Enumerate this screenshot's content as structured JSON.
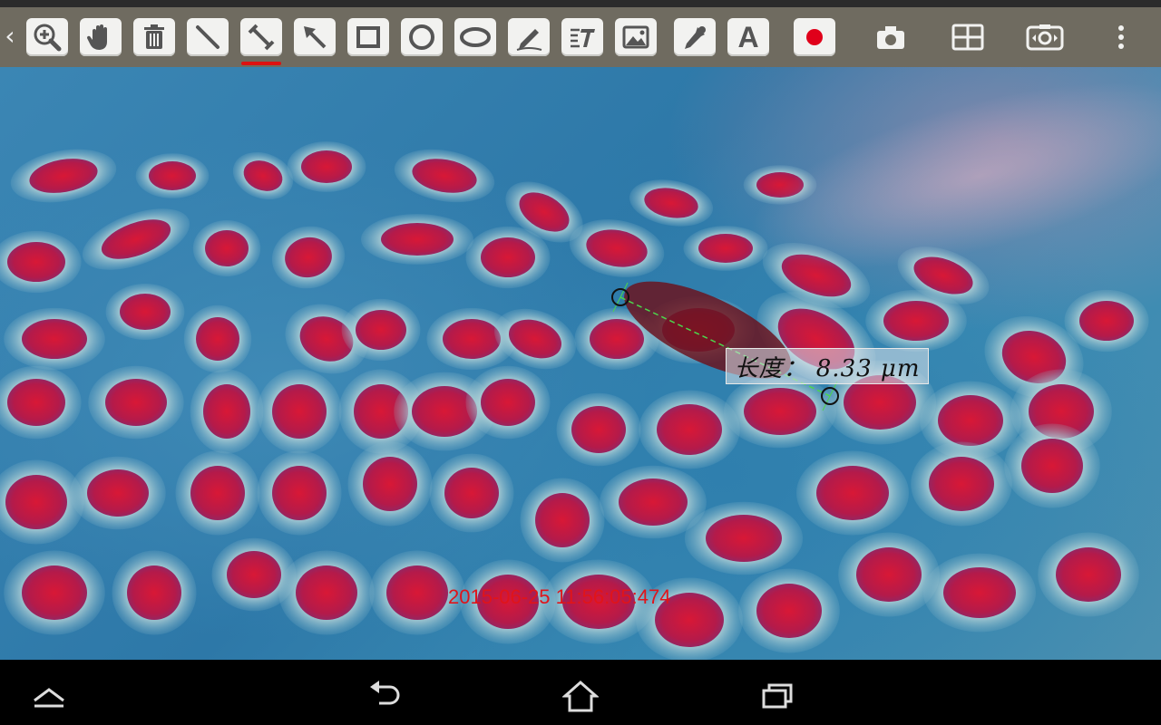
{
  "toolbar": {
    "back_glyph": "‹",
    "tools": [
      {
        "name": "zoom-icon",
        "label": "zoom"
      },
      {
        "name": "hand-icon",
        "label": "pan"
      },
      {
        "name": "trash-icon",
        "label": "delete"
      },
      {
        "name": "line-icon",
        "label": "line"
      },
      {
        "name": "measure-line-icon",
        "label": "measure line",
        "active": true
      },
      {
        "name": "arrow-icon",
        "label": "arrow"
      },
      {
        "name": "rectangle-icon",
        "label": "rectangle"
      },
      {
        "name": "circle-icon",
        "label": "circle"
      },
      {
        "name": "ellipse-icon",
        "label": "ellipse"
      },
      {
        "name": "pen-icon",
        "label": "freehand"
      },
      {
        "name": "text-style-icon",
        "label": "text style"
      },
      {
        "name": "image-icon",
        "label": "image"
      },
      {
        "name": "eyedropper-icon",
        "label": "color picker"
      },
      {
        "name": "text-icon",
        "label": "text"
      },
      {
        "name": "record-icon",
        "label": "record"
      },
      {
        "name": "snapshot-icon",
        "label": "snapshot"
      },
      {
        "name": "grid-icon",
        "label": "grid"
      },
      {
        "name": "camera-switch-icon",
        "label": "camera"
      },
      {
        "name": "overflow-menu-icon",
        "label": "more"
      }
    ],
    "text_tool_glyph": "A",
    "accent_color": "#d11111",
    "record_color": "#e0001a"
  },
  "measurement": {
    "label": "长度： 8.33 μm",
    "line_color": "#4cd64c"
  },
  "timestamp": "2015-06-25 11:56:05:474",
  "timestamp_color": "#e0141a",
  "navbar": {
    "buttons": [
      "nav-up",
      "nav-back",
      "nav-home",
      "nav-recents"
    ]
  }
}
